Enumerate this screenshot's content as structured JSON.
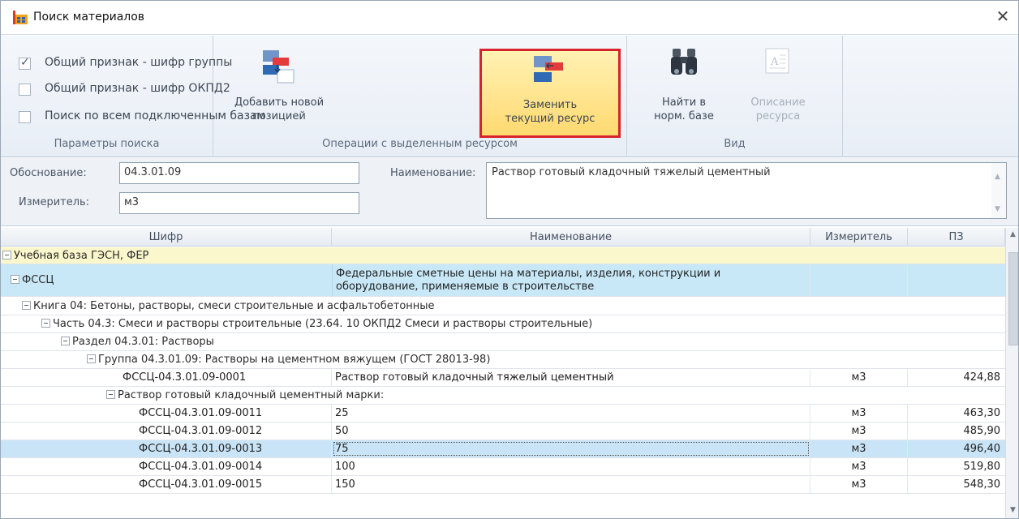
{
  "window": {
    "title": "Поиск материалов",
    "close_glyph": "✕"
  },
  "ribbon": {
    "search_params": {
      "label": "Параметры поиска",
      "options": [
        {
          "label": "Общий признак - шифр группы",
          "checked": true
        },
        {
          "label": "Общий признак - шифр ОКПД2",
          "checked": false
        },
        {
          "label": "Поиск по всем подключенным базам",
          "checked": false
        }
      ]
    },
    "operations": {
      "label": "Операции с выделенным ресурсом",
      "add_new": "Добавить новой\nпозицией",
      "replace_current": "Заменить\nтекущий ресурс"
    },
    "view": {
      "label": "Вид",
      "find_in_base": "Найти в\nнорм. базе",
      "description": "Описание\nресурса"
    }
  },
  "form": {
    "justification_label": "Обоснование:",
    "justification_value": "04.3.01.09",
    "unit_label": "Измеритель:",
    "unit_value": "м3",
    "name_label": "Наименование:",
    "name_value": "Раствор готовый кладочный тяжелый цементный"
  },
  "grid": {
    "headers": {
      "code": "Шифр",
      "name": "Наименование",
      "unit": "Измеритель",
      "price": "ПЗ"
    },
    "groups": {
      "base": "Учебная база ГЭСН, ФЕР",
      "fsc_code": "ФССЦ",
      "fsc_name_1": "Федеральные сметные цены на материалы, изделия, конструкции и",
      "fsc_name_2": "оборудование, применяемые в строительстве",
      "book": "Книга 04: Бетоны, растворы, смеси строительные и асфальтобетонные",
      "part": "Часть 04.3: Смеси и растворы строительные (23.64. 10 ОКПД2 Смеси и растворы строительные)",
      "section": "Раздел 04.3.01: Растворы",
      "group": "Группа 04.3.01.09: Растворы на цементном вяжущем (ГОСТ 28013-98)",
      "subgroup": "Раствор готовый кладочный цементный марки:"
    },
    "rows": [
      {
        "code": "ФССЦ-04.3.01.09-0001",
        "name": "Раствор готовый кладочный тяжелый цементный",
        "unit": "м3",
        "price": "424,88"
      },
      {
        "code": "ФССЦ-04.3.01.09-0011",
        "name": "25",
        "unit": "м3",
        "price": "463,30"
      },
      {
        "code": "ФССЦ-04.3.01.09-0012",
        "name": "50",
        "unit": "м3",
        "price": "485,90"
      },
      {
        "code": "ФССЦ-04.3.01.09-0013",
        "name": "75",
        "unit": "м3",
        "price": "496,40"
      },
      {
        "code": "ФССЦ-04.3.01.09-0014",
        "name": "100",
        "unit": "м3",
        "price": "519,80"
      },
      {
        "code": "ФССЦ-04.3.01.09-0015",
        "name": "150",
        "unit": "м3",
        "price": "548,30"
      }
    ]
  },
  "colors": {
    "highlight_border": "#d6232d",
    "selected_row": "#c9e4f6",
    "fsc_row": "#c8e8f7",
    "base_row": "#fbf7cc"
  }
}
